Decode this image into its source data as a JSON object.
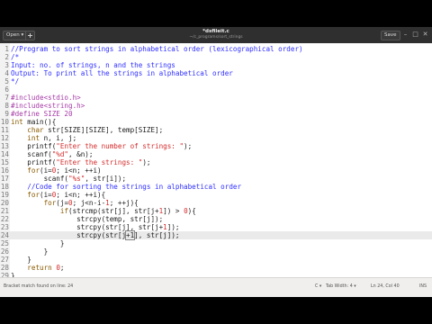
{
  "titlebar": {
    "open_label": "Open ▾",
    "title": "*dsfileit.c",
    "subtitle": "~/c_programs/sort_strings",
    "save_label": "Save",
    "controls": [
      "–",
      "□",
      "✕"
    ]
  },
  "colors": {
    "comment": "#2f2fff",
    "preprocessor": "#a63ba6",
    "keyword": "#8a5a00",
    "string": "#d52b2b",
    "number": "#d52b2b",
    "text": "#1a1a1a",
    "current_line": "#eaeaea"
  },
  "editor": {
    "current_line": 24,
    "lines": [
      {
        "n": "1",
        "segs": [
          {
            "t": "//Program to sort strings in alphabetical order (lexicographical order)",
            "c": "comment"
          }
        ]
      },
      {
        "n": "2",
        "segs": [
          {
            "t": "/*",
            "c": "comment"
          }
        ]
      },
      {
        "n": "3",
        "segs": [
          {
            "t": "Input: no. of strings, n and the strings",
            "c": "comment"
          }
        ]
      },
      {
        "n": "4",
        "segs": [
          {
            "t": "Output: To print all the strings in alphabetical order",
            "c": "comment"
          }
        ]
      },
      {
        "n": "5",
        "segs": [
          {
            "t": "*/",
            "c": "comment"
          }
        ]
      },
      {
        "n": "6",
        "segs": []
      },
      {
        "n": "7",
        "segs": [
          {
            "t": "#include<stdio.h>",
            "c": "preprocessor"
          }
        ]
      },
      {
        "n": "8",
        "segs": [
          {
            "t": "#include<string.h>",
            "c": "preprocessor"
          }
        ]
      },
      {
        "n": "9",
        "segs": [
          {
            "t": "#define SIZE 20",
            "c": "preprocessor"
          }
        ]
      },
      {
        "n": "10",
        "segs": [
          {
            "t": "int",
            "c": "keyword"
          },
          {
            "t": " main(){",
            "c": "text"
          }
        ]
      },
      {
        "n": "11",
        "segs": [
          {
            "t": "    ",
            "c": "text"
          },
          {
            "t": "char",
            "c": "keyword"
          },
          {
            "t": " str[SIZE][SIZE], temp[SIZE];",
            "c": "text"
          }
        ]
      },
      {
        "n": "12",
        "segs": [
          {
            "t": "    ",
            "c": "text"
          },
          {
            "t": "int",
            "c": "keyword"
          },
          {
            "t": " n, i, j;",
            "c": "text"
          }
        ]
      },
      {
        "n": "13",
        "segs": [
          {
            "t": "    printf(",
            "c": "text"
          },
          {
            "t": "\"Enter the number of strings: \"",
            "c": "string"
          },
          {
            "t": ");",
            "c": "text"
          }
        ]
      },
      {
        "n": "14",
        "segs": [
          {
            "t": "    scanf(",
            "c": "text"
          },
          {
            "t": "\"%d\"",
            "c": "string"
          },
          {
            "t": ", &n);",
            "c": "text"
          }
        ]
      },
      {
        "n": "15",
        "segs": [
          {
            "t": "    printf(",
            "c": "text"
          },
          {
            "t": "\"Enter the strings: \"",
            "c": "string"
          },
          {
            "t": ");",
            "c": "text"
          }
        ]
      },
      {
        "n": "16",
        "segs": [
          {
            "t": "    ",
            "c": "text"
          },
          {
            "t": "for",
            "c": "keyword"
          },
          {
            "t": "(i=",
            "c": "text"
          },
          {
            "t": "0",
            "c": "number"
          },
          {
            "t": "; i<n; ++i)",
            "c": "text"
          }
        ]
      },
      {
        "n": "17",
        "segs": [
          {
            "t": "        scanf(",
            "c": "text"
          },
          {
            "t": "\"%s\"",
            "c": "string"
          },
          {
            "t": ", str[i]);",
            "c": "text"
          }
        ]
      },
      {
        "n": "18",
        "segs": [
          {
            "t": "    ",
            "c": "text"
          },
          {
            "t": "//Code for sorting the strings in alphabetical order",
            "c": "comment"
          }
        ]
      },
      {
        "n": "19",
        "segs": [
          {
            "t": "    ",
            "c": "text"
          },
          {
            "t": "for",
            "c": "keyword"
          },
          {
            "t": "(i=",
            "c": "text"
          },
          {
            "t": "0",
            "c": "number"
          },
          {
            "t": "; i<n; ++i){",
            "c": "text"
          }
        ]
      },
      {
        "n": "20",
        "segs": [
          {
            "t": "        ",
            "c": "text"
          },
          {
            "t": "for",
            "c": "keyword"
          },
          {
            "t": "(j=",
            "c": "text"
          },
          {
            "t": "0",
            "c": "number"
          },
          {
            "t": "; j<n-i-",
            "c": "text"
          },
          {
            "t": "1",
            "c": "number"
          },
          {
            "t": "; ++j){",
            "c": "text"
          }
        ]
      },
      {
        "n": "21",
        "segs": [
          {
            "t": "            ",
            "c": "text"
          },
          {
            "t": "if",
            "c": "keyword"
          },
          {
            "t": "(strcmp(str[j], str[j+",
            "c": "text"
          },
          {
            "t": "1",
            "c": "number"
          },
          {
            "t": "]) > ",
            "c": "text"
          },
          {
            "t": "0",
            "c": "number"
          },
          {
            "t": "){",
            "c": "text"
          }
        ]
      },
      {
        "n": "22",
        "segs": [
          {
            "t": "                strcpy(temp, str[j]);",
            "c": "text"
          }
        ]
      },
      {
        "n": "23",
        "segs": [
          {
            "t": "                strcpy(str[j], str[j+",
            "c": "text"
          },
          {
            "t": "1",
            "c": "number"
          },
          {
            "t": "]);",
            "c": "text"
          }
        ]
      },
      {
        "n": "24",
        "segs": [
          {
            "t": "                strcpy(str[j",
            "c": "text"
          },
          {
            "t": "+1",
            "c": "cursor"
          },
          {
            "t": "], str[j]);",
            "c": "text"
          }
        ]
      },
      {
        "n": "25",
        "segs": [
          {
            "t": "            }",
            "c": "text"
          }
        ]
      },
      {
        "n": "26",
        "segs": [
          {
            "t": "        }",
            "c": "text"
          }
        ]
      },
      {
        "n": "27",
        "segs": [
          {
            "t": "    }",
            "c": "text"
          }
        ]
      },
      {
        "n": "28",
        "segs": [
          {
            "t": "    ",
            "c": "text"
          },
          {
            "t": "return",
            "c": "keyword"
          },
          {
            "t": " ",
            "c": "text"
          },
          {
            "t": "0",
            "c": "number"
          },
          {
            "t": ";",
            "c": "text"
          }
        ]
      },
      {
        "n": "29",
        "segs": [
          {
            "t": "}",
            "c": "text"
          }
        ]
      }
    ]
  },
  "statusbar": {
    "message": "Bracket match found on line: 24",
    "language": "C ▾",
    "tab_width": "Tab Width: 4 ▾",
    "position": "Ln 24, Col 40",
    "mode": "INS"
  }
}
